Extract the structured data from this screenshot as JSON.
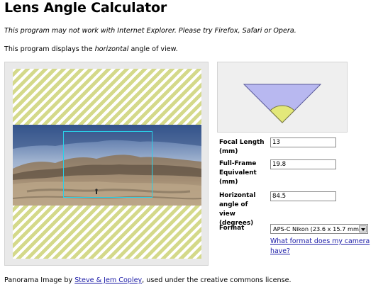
{
  "page": {
    "title": "Lens Angle Calculator",
    "warning": "This program may not work with Internet Explorer. Please try Firefox, Safari or Opera.",
    "description_before": "This program displays the ",
    "description_emphasis": "horizontal",
    "description_after": " angle of view."
  },
  "form": {
    "focal_length": {
      "label": "Focal Length (mm)",
      "value": "13"
    },
    "full_frame": {
      "label": "Full-Frame Equivalent (mm)",
      "value": "19.8"
    },
    "horizontal_angle": {
      "label": "Horizontal angle of view (degrees)",
      "value": "84.5"
    },
    "format": {
      "label": "Format",
      "selected": "APS-C Nikon (23.6 x 15.7 mm)"
    },
    "help_link": "What format does my camera have?"
  },
  "credit": {
    "before": "Panorama Image by ",
    "link": "Steve & Jem Copley",
    "after": ", used under the creative commons license."
  },
  "colors": {
    "stripe": "#d4d98a",
    "diagram_triangle": "#b8b8f0",
    "diagram_arc": "#e3e87a",
    "view_box": "#2ad0e8",
    "link": "#1a1aa6"
  }
}
